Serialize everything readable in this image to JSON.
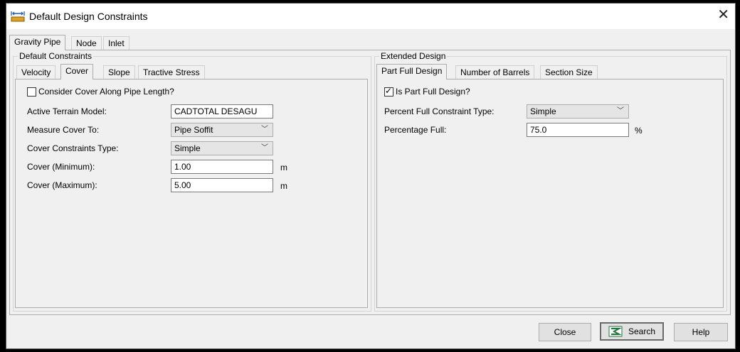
{
  "window": {
    "title": "Default Design Constraints",
    "close_glyph": "✕"
  },
  "top_tabs": [
    {
      "label": "Gravity Pipe"
    },
    {
      "label": "Node"
    },
    {
      "label": "Inlet"
    }
  ],
  "left": {
    "group_label": "Default Constraints",
    "tabs": [
      {
        "label": "Velocity"
      },
      {
        "label": "Cover"
      },
      {
        "label": "Slope"
      },
      {
        "label": "Tractive Stress"
      }
    ],
    "consider_cover_label": "Consider Cover Along Pipe Length?",
    "consider_cover_checked": false,
    "terrain_label": "Active Terrain Model:",
    "terrain_value": "CADTOTAL DESAGU",
    "measure_label": "Measure Cover To:",
    "measure_value": "Pipe Soffit",
    "constraints_type_label": "Cover Constraints Type:",
    "constraints_type_value": "Simple",
    "cover_min_label": "Cover (Minimum):",
    "cover_min_value": "1.00",
    "cover_min_unit": "m",
    "cover_max_label": "Cover (Maximum):",
    "cover_max_value": "5.00",
    "cover_max_unit": "m"
  },
  "right": {
    "group_label": "Extended Design",
    "tabs": [
      {
        "label": "Part Full Design"
      },
      {
        "label": "Number of Barrels"
      },
      {
        "label": "Section Size"
      }
    ],
    "is_part_full_label": "Is Part Full Design?",
    "is_part_full_checked": true,
    "percent_type_label": "Percent Full Constraint Type:",
    "percent_type_value": "Simple",
    "percentage_full_label": "Percentage Full:",
    "percentage_full_value": "75.0",
    "percentage_full_unit": "%"
  },
  "buttons": {
    "close": "Close",
    "search": "Search",
    "help": "Help"
  }
}
